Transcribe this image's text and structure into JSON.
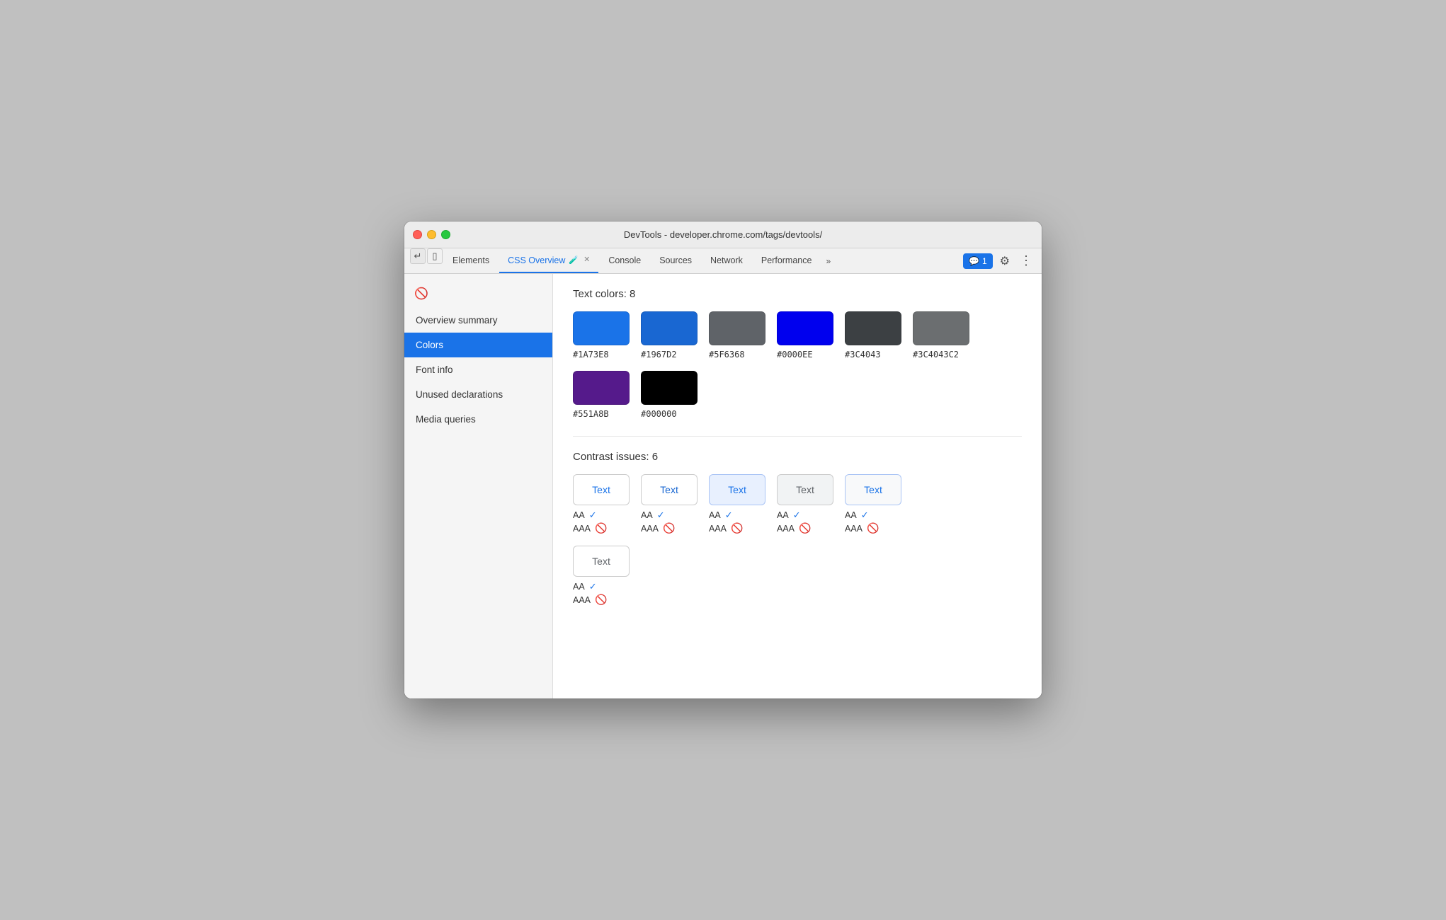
{
  "window": {
    "title": "DevTools - developer.chrome.com/tags/devtools/"
  },
  "titlebar": {
    "title": "DevTools - developer.chrome.com/tags/devtools/"
  },
  "tabs": [
    {
      "id": "elements",
      "label": "Elements",
      "active": false
    },
    {
      "id": "css-overview",
      "label": "CSS Overview",
      "active": true,
      "hasBeaker": true,
      "hasClose": true
    },
    {
      "id": "console",
      "label": "Console",
      "active": false
    },
    {
      "id": "sources",
      "label": "Sources",
      "active": false
    },
    {
      "id": "network",
      "label": "Network",
      "active": false
    },
    {
      "id": "performance",
      "label": "Performance",
      "active": false
    }
  ],
  "tab_more_label": "»",
  "tab_chat_label": "1",
  "sidebar": {
    "items": [
      {
        "id": "overview-summary",
        "label": "Overview summary",
        "active": false
      },
      {
        "id": "colors",
        "label": "Colors",
        "active": true
      },
      {
        "id": "font-info",
        "label": "Font info",
        "active": false
      },
      {
        "id": "unused-declarations",
        "label": "Unused declarations",
        "active": false
      },
      {
        "id": "media-queries",
        "label": "Media queries",
        "active": false
      }
    ]
  },
  "main": {
    "text_colors_header": "Text colors: 8",
    "text_colors": [
      {
        "hex": "#1A73E8",
        "color": "#1a73e8"
      },
      {
        "hex": "#1967D2",
        "color": "#1967d2"
      },
      {
        "hex": "#5F6368",
        "color": "#5f6368"
      },
      {
        "hex": "#0000EE",
        "color": "#0000ee"
      },
      {
        "hex": "#3C4043",
        "color": "#3c4043"
      },
      {
        "hex": "#3C4043C2",
        "color": "rgba(60,64,67,0.76)"
      },
      {
        "hex": "#551A8B",
        "color": "#551a8b"
      },
      {
        "hex": "#000000",
        "color": "#000000"
      }
    ],
    "contrast_issues_header": "Contrast issues: 6",
    "contrast_items": [
      {
        "text": "Text",
        "text_color": "#1a73e8",
        "bg_color": "#ffffff",
        "border_color": "#ccc",
        "aa_pass": true,
        "aaa_pass": false
      },
      {
        "text": "Text",
        "text_color": "#1967d2",
        "bg_color": "#ffffff",
        "border_color": "#ccc",
        "aa_pass": true,
        "aaa_pass": false
      },
      {
        "text": "Text",
        "text_color": "#1a73e8",
        "bg_color": "#e8f0fe",
        "border_color": "#aac4f5",
        "aa_pass": true,
        "aaa_pass": false
      },
      {
        "text": "Text",
        "text_color": "#5f6368",
        "bg_color": "#f1f3f4",
        "border_color": "#ccc",
        "aa_pass": true,
        "aaa_pass": false
      },
      {
        "text": "Text",
        "text_color": "#1a73e8",
        "bg_color": "#f8f9fa",
        "border_color": "#aac4f5",
        "aa_pass": true,
        "aaa_pass": false
      },
      {
        "text": "Text",
        "text_color": "#5f6368",
        "bg_color": "#ffffff",
        "border_color": "#ccc",
        "aa_pass": true,
        "aaa_pass": false
      }
    ],
    "aa_label": "AA",
    "aaa_label": "AAA"
  }
}
